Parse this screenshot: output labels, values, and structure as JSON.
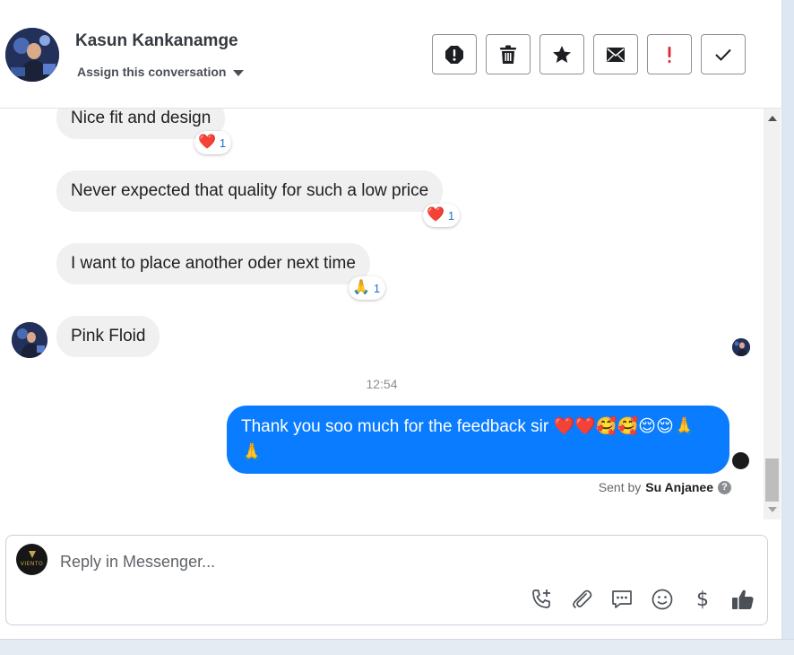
{
  "header": {
    "contact_name": "Kasun Kankanamge",
    "assign_label": "Assign this conversation",
    "actions": [
      {
        "name": "spam-button",
        "icon": "octagon-alert-icon"
      },
      {
        "name": "delete-button",
        "icon": "trash-icon"
      },
      {
        "name": "star-button",
        "icon": "star-icon"
      },
      {
        "name": "mark-unread-button",
        "icon": "envelope-icon"
      },
      {
        "name": "follow-up-button",
        "icon": "exclamation-icon"
      },
      {
        "name": "mark-done-button",
        "icon": "checkmark-icon"
      }
    ]
  },
  "messages": {
    "incoming": [
      {
        "text": "Nice fit and design",
        "reaction_icon": "heart",
        "reaction_count": "1"
      },
      {
        "text": "Never expected that quality for such a low price",
        "reaction_icon": "heart",
        "reaction_count": "1"
      },
      {
        "text": "I want to place another oder next time",
        "reaction_icon": "folded-hands",
        "reaction_count": "1"
      },
      {
        "text": "Pink Floid"
      }
    ],
    "timestamp": "12:54",
    "outgoing": {
      "text": "Thank you soo much for the feedback sir ❤️❤️🥰🥰😌😌🙏🙏",
      "sent_by_prefix": "Sent by",
      "sent_by_name": "Su Anjanee"
    }
  },
  "composer": {
    "placeholder": "Reply in Messenger...",
    "brand_label": "VIENTO",
    "tools": [
      "phone-plus-icon",
      "paperclip-icon",
      "saved-replies-icon",
      "smiley-icon",
      "dollar-icon",
      "thumbs-up-icon"
    ]
  },
  "colors": {
    "outgoing_bubble": "#0a7cff",
    "incoming_bubble": "#f0f0f0",
    "reaction_count": "#1a6fd6",
    "follow_up_red": "#e0262b"
  }
}
